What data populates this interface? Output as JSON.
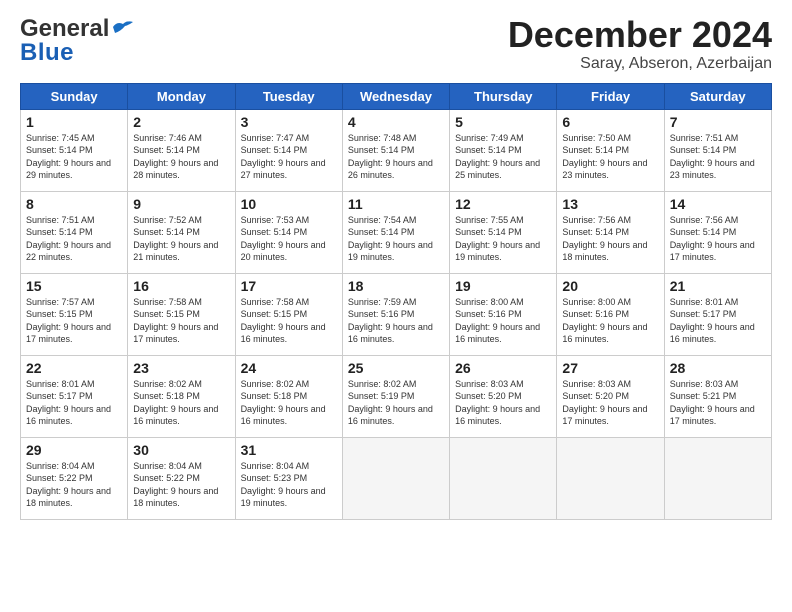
{
  "header": {
    "logo_general": "General",
    "logo_blue": "Blue",
    "month_year": "December 2024",
    "location": "Saray, Abseron, Azerbaijan"
  },
  "weekdays": [
    "Sunday",
    "Monday",
    "Tuesday",
    "Wednesday",
    "Thursday",
    "Friday",
    "Saturday"
  ],
  "weeks": [
    [
      {
        "day": "1",
        "sunrise": "7:45 AM",
        "sunset": "5:14 PM",
        "daylight": "9 hours and 29 minutes."
      },
      {
        "day": "2",
        "sunrise": "7:46 AM",
        "sunset": "5:14 PM",
        "daylight": "9 hours and 28 minutes."
      },
      {
        "day": "3",
        "sunrise": "7:47 AM",
        "sunset": "5:14 PM",
        "daylight": "9 hours and 27 minutes."
      },
      {
        "day": "4",
        "sunrise": "7:48 AM",
        "sunset": "5:14 PM",
        "daylight": "9 hours and 26 minutes."
      },
      {
        "day": "5",
        "sunrise": "7:49 AM",
        "sunset": "5:14 PM",
        "daylight": "9 hours and 25 minutes."
      },
      {
        "day": "6",
        "sunrise": "7:50 AM",
        "sunset": "5:14 PM",
        "daylight": "9 hours and 23 minutes."
      },
      {
        "day": "7",
        "sunrise": "7:51 AM",
        "sunset": "5:14 PM",
        "daylight": "9 hours and 23 minutes."
      }
    ],
    [
      {
        "day": "8",
        "sunrise": "7:51 AM",
        "sunset": "5:14 PM",
        "daylight": "9 hours and 22 minutes."
      },
      {
        "day": "9",
        "sunrise": "7:52 AM",
        "sunset": "5:14 PM",
        "daylight": "9 hours and 21 minutes."
      },
      {
        "day": "10",
        "sunrise": "7:53 AM",
        "sunset": "5:14 PM",
        "daylight": "9 hours and 20 minutes."
      },
      {
        "day": "11",
        "sunrise": "7:54 AM",
        "sunset": "5:14 PM",
        "daylight": "9 hours and 19 minutes."
      },
      {
        "day": "12",
        "sunrise": "7:55 AM",
        "sunset": "5:14 PM",
        "daylight": "9 hours and 19 minutes."
      },
      {
        "day": "13",
        "sunrise": "7:56 AM",
        "sunset": "5:14 PM",
        "daylight": "9 hours and 18 minutes."
      },
      {
        "day": "14",
        "sunrise": "7:56 AM",
        "sunset": "5:14 PM",
        "daylight": "9 hours and 17 minutes."
      }
    ],
    [
      {
        "day": "15",
        "sunrise": "7:57 AM",
        "sunset": "5:15 PM",
        "daylight": "9 hours and 17 minutes."
      },
      {
        "day": "16",
        "sunrise": "7:58 AM",
        "sunset": "5:15 PM",
        "daylight": "9 hours and 17 minutes."
      },
      {
        "day": "17",
        "sunrise": "7:58 AM",
        "sunset": "5:15 PM",
        "daylight": "9 hours and 16 minutes."
      },
      {
        "day": "18",
        "sunrise": "7:59 AM",
        "sunset": "5:16 PM",
        "daylight": "9 hours and 16 minutes."
      },
      {
        "day": "19",
        "sunrise": "8:00 AM",
        "sunset": "5:16 PM",
        "daylight": "9 hours and 16 minutes."
      },
      {
        "day": "20",
        "sunrise": "8:00 AM",
        "sunset": "5:16 PM",
        "daylight": "9 hours and 16 minutes."
      },
      {
        "day": "21",
        "sunrise": "8:01 AM",
        "sunset": "5:17 PM",
        "daylight": "9 hours and 16 minutes."
      }
    ],
    [
      {
        "day": "22",
        "sunrise": "8:01 AM",
        "sunset": "5:17 PM",
        "daylight": "9 hours and 16 minutes."
      },
      {
        "day": "23",
        "sunrise": "8:02 AM",
        "sunset": "5:18 PM",
        "daylight": "9 hours and 16 minutes."
      },
      {
        "day": "24",
        "sunrise": "8:02 AM",
        "sunset": "5:18 PM",
        "daylight": "9 hours and 16 minutes."
      },
      {
        "day": "25",
        "sunrise": "8:02 AM",
        "sunset": "5:19 PM",
        "daylight": "9 hours and 16 minutes."
      },
      {
        "day": "26",
        "sunrise": "8:03 AM",
        "sunset": "5:20 PM",
        "daylight": "9 hours and 16 minutes."
      },
      {
        "day": "27",
        "sunrise": "8:03 AM",
        "sunset": "5:20 PM",
        "daylight": "9 hours and 17 minutes."
      },
      {
        "day": "28",
        "sunrise": "8:03 AM",
        "sunset": "5:21 PM",
        "daylight": "9 hours and 17 minutes."
      }
    ],
    [
      {
        "day": "29",
        "sunrise": "8:04 AM",
        "sunset": "5:22 PM",
        "daylight": "9 hours and 18 minutes."
      },
      {
        "day": "30",
        "sunrise": "8:04 AM",
        "sunset": "5:22 PM",
        "daylight": "9 hours and 18 minutes."
      },
      {
        "day": "31",
        "sunrise": "8:04 AM",
        "sunset": "5:23 PM",
        "daylight": "9 hours and 19 minutes."
      },
      null,
      null,
      null,
      null
    ]
  ],
  "labels": {
    "sunrise": "Sunrise:",
    "sunset": "Sunset:",
    "daylight": "Daylight:"
  }
}
